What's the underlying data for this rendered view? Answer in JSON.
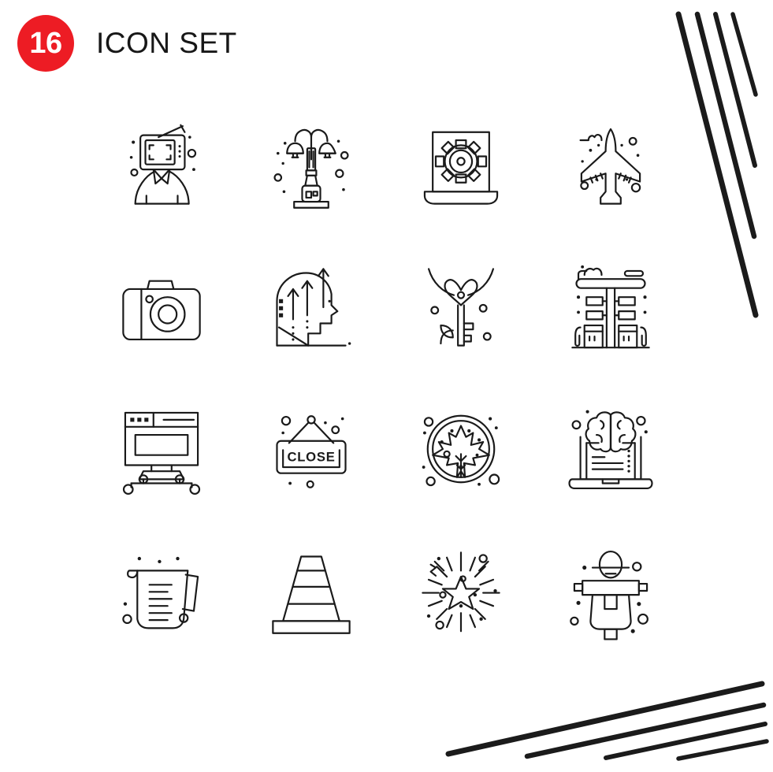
{
  "header": {
    "count": "16",
    "title": "Icon Set"
  },
  "colors": {
    "badge_background": "#ed1c24",
    "badge_text": "#ffffff",
    "title_text": "#171717",
    "icon_stroke": "#1a1a1a",
    "page_background": "#ffffff",
    "decoration_stroke": "#1b1b1b"
  },
  "grid": {
    "columns": 4,
    "rows": 4,
    "total": 16
  },
  "icons": [
    {
      "position": 1,
      "row": 1,
      "col": 1,
      "name": "tv-head-person-icon",
      "label": "Television Head Person"
    },
    {
      "position": 2,
      "row": 1,
      "col": 2,
      "name": "street-lamp-icon",
      "label": "Street Lamp Post"
    },
    {
      "position": 3,
      "row": 1,
      "col": 3,
      "name": "laptop-settings-icon",
      "label": "Laptop Settings Gear"
    },
    {
      "position": 4,
      "row": 1,
      "col": 4,
      "name": "airplane-icon",
      "label": "Airplane"
    },
    {
      "position": 5,
      "row": 2,
      "col": 1,
      "name": "camera-icon",
      "label": "Photo Camera"
    },
    {
      "position": 6,
      "row": 2,
      "col": 2,
      "name": "head-arrows-growth-icon",
      "label": "Head With Growth Arrows"
    },
    {
      "position": 7,
      "row": 2,
      "col": 3,
      "name": "heart-key-necklace-icon",
      "label": "Heart Key Necklace"
    },
    {
      "position": 8,
      "row": 2,
      "col": 4,
      "name": "gas-station-icon",
      "label": "Gas Station"
    },
    {
      "position": 9,
      "row": 3,
      "col": 1,
      "name": "browser-stand-icon",
      "label": "Browser Window On Stand"
    },
    {
      "position": 10,
      "row": 3,
      "col": 2,
      "name": "close-sign-icon",
      "label": "Close Hanging Sign",
      "text": "CLOSE"
    },
    {
      "position": 11,
      "row": 3,
      "col": 3,
      "name": "maple-leaf-badge-icon",
      "label": "Maple Leaf Badge"
    },
    {
      "position": 12,
      "row": 3,
      "col": 4,
      "name": "brain-laptop-icon",
      "label": "Brain Laptop Learning"
    },
    {
      "position": 13,
      "row": 4,
      "col": 1,
      "name": "measuring-cup-icon",
      "label": "Measuring Cup"
    },
    {
      "position": 14,
      "row": 4,
      "col": 2,
      "name": "traffic-cone-icon",
      "label": "Traffic Cone"
    },
    {
      "position": 15,
      "row": 4,
      "col": 3,
      "name": "firework-star-icon",
      "label": "Firework Star Burst"
    },
    {
      "position": 16,
      "row": 4,
      "col": 4,
      "name": "scarecrow-icon",
      "label": "Scarecrow"
    }
  ],
  "decorations": {
    "top_right": {
      "name": "diagonal-stroke-decoration-top-right",
      "stroke_count": 4
    },
    "bottom_right": {
      "name": "diagonal-stroke-decoration-bottom-right",
      "stroke_count": 4
    }
  }
}
